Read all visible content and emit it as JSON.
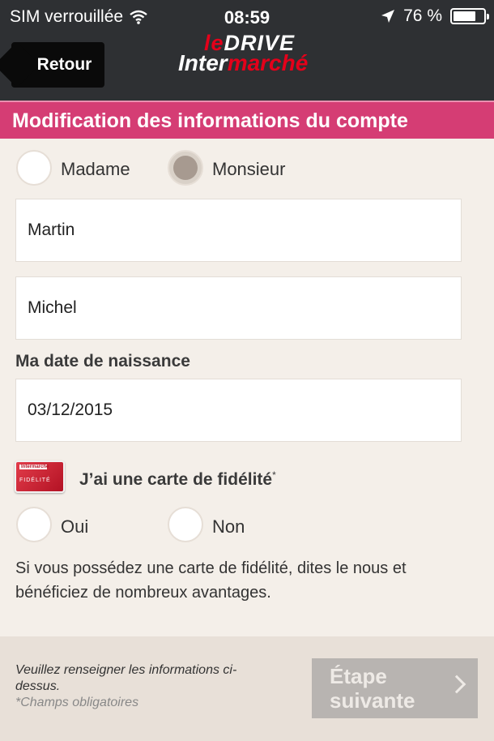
{
  "status_bar": {
    "carrier": "SIM verrouillée",
    "time": "08:59",
    "battery": "76 %",
    "battery_level": 0.76
  },
  "nav": {
    "back_label": "Retour",
    "logo_le": "le",
    "logo_drive": "DRIVE",
    "logo_inter": "Inter",
    "logo_marche": "marché"
  },
  "section": {
    "title": "Modification des informations du compte"
  },
  "civility": {
    "options": [
      {
        "label": "Madame",
        "selected": false
      },
      {
        "label": "Monsieur",
        "selected": true
      }
    ]
  },
  "form": {
    "last_name": "Martin",
    "first_name": "Michel",
    "birthdate_label": "Ma date de naissance",
    "birthdate": "03/12/2015"
  },
  "loyalty": {
    "question": "J’ai une carte de fidélité",
    "asterisk": "*",
    "card_icon_brand": "Intermarché",
    "card_icon_text": "FIDÉLITÉ",
    "options": [
      {
        "label": "Oui",
        "selected": false
      },
      {
        "label": "Non",
        "selected": false
      }
    ],
    "info": "Si vous possédez une carte de fidélité, dites le nous et bénéficiez de nombreux avantages."
  },
  "footer": {
    "message": "Veuillez renseigner les informations ci-dessus.",
    "required_note": "*Champs obligatoires",
    "next_label": "Étape suivante"
  },
  "colors": {
    "topbar": "#2e3033",
    "section": "#d53d74",
    "brand_red": "#e4001a",
    "next_disabled": "#b8b4b1"
  }
}
